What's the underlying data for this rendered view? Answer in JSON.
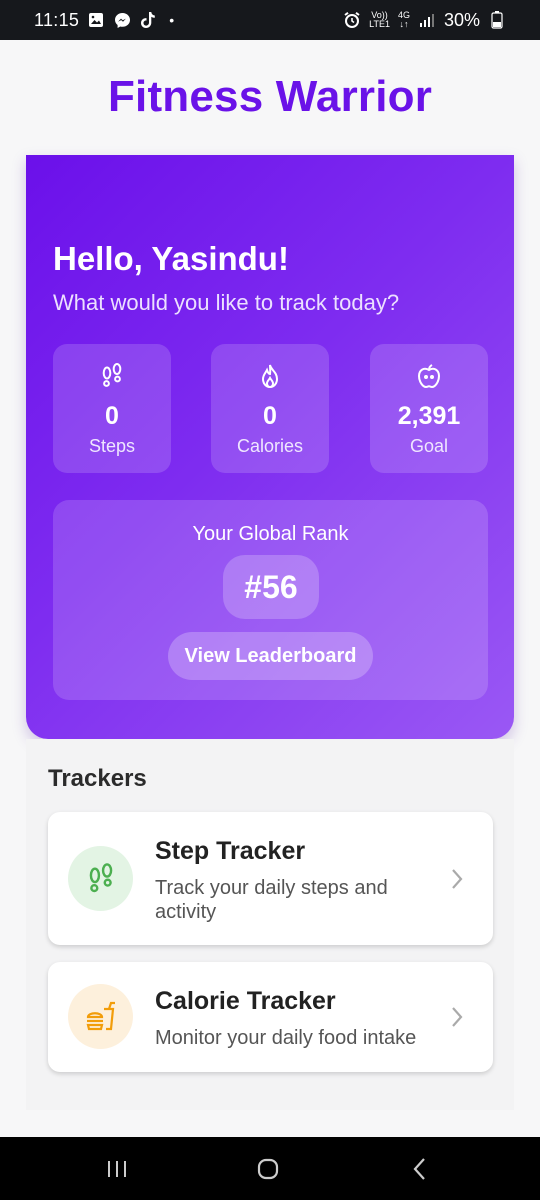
{
  "status_bar": {
    "time": "11:15",
    "volte_label": "Vo))",
    "lte_label": "LTE1",
    "network_label": "4G",
    "battery": "30%"
  },
  "app_title": "Fitness Warrior",
  "hero": {
    "greeting": "Hello, Yasindu!",
    "subtitle": "What would you like to track today?",
    "stats": [
      {
        "value": "0",
        "label": "Steps",
        "icon": "footsteps-icon"
      },
      {
        "value": "0",
        "label": "Calories",
        "icon": "flame-icon"
      },
      {
        "value": "2,391",
        "label": "Goal",
        "icon": "apple-icon"
      }
    ],
    "rank": {
      "title": "Your Global Rank",
      "value": "#56",
      "button_label": "View Leaderboard"
    }
  },
  "trackers_section": {
    "title": "Trackers",
    "items": [
      {
        "name": "Step Tracker",
        "description": "Track your daily steps and activity",
        "icon": "footsteps-icon",
        "icon_color": "#4caf50",
        "icon_bg": "#e3f4e4"
      },
      {
        "name": "Calorie Tracker",
        "description": "Monitor your daily food intake",
        "icon": "fastfood-icon",
        "icon_color": "#f29d0a",
        "icon_bg": "#fdf0dc"
      }
    ]
  },
  "colors": {
    "brand": "#6a12e8",
    "hero_gradient_start": "#6b10ea",
    "hero_gradient_end": "#9a58f4"
  }
}
